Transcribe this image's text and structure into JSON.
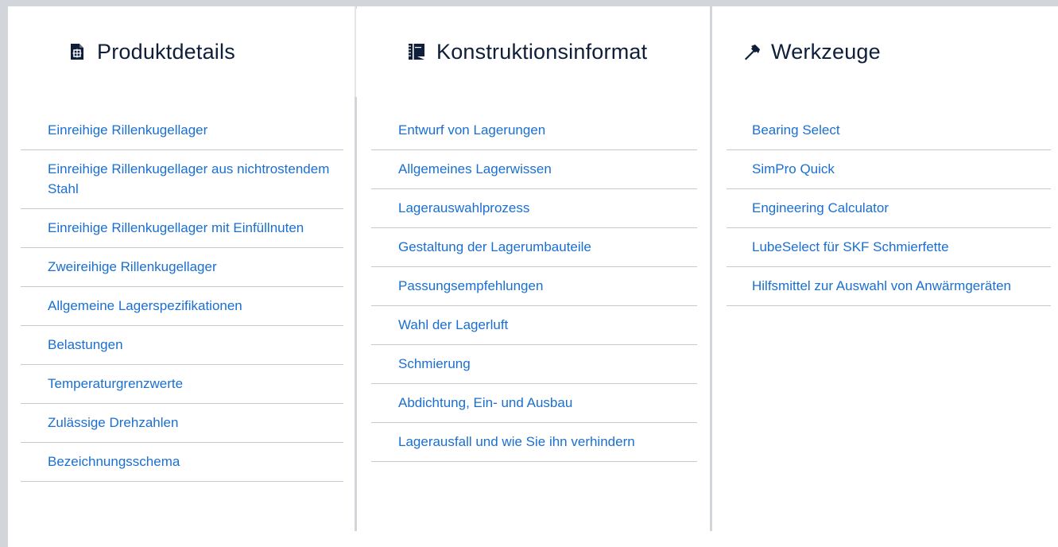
{
  "columns": [
    {
      "title": "Produktdetails",
      "icon": "document-icon",
      "items": [
        "Einreihige Rillenkugellager",
        "Einreihige Rillenkugellager aus nichtrostendem Stahl",
        "Einreihige Rillenkugellager mit Einfüllnuten",
        "Zweireihige Rillenkugellager",
        "Allgemeine Lagerspezifikationen",
        "Belastungen",
        "Temperaturgrenzwerte",
        "Zulässige Drehzahlen",
        "Bezeichnungsschema"
      ]
    },
    {
      "title": "Konstruktionsinformat",
      "icon": "blueprint-icon",
      "items": [
        "Entwurf von Lagerungen",
        "Allgemeines Lagerwissen",
        "Lagerauswahlprozess",
        "Gestaltung der Lagerumbauteile",
        "Passungsempfehlungen",
        "Wahl der Lagerluft",
        "Schmierung",
        "Abdichtung, Ein- und Ausbau",
        "Lagerausfall und wie Sie ihn verhindern"
      ]
    },
    {
      "title": "Werkzeuge",
      "icon": "hammer-icon",
      "items": [
        "Bearing Select",
        "SimPro Quick",
        "Engineering Calculator",
        "LubeSelect für SKF Schmierfette",
        "Hilfsmittel zur Auswahl von Anwärmgeräten"
      ]
    }
  ],
  "colors": {
    "link": "#1a6fd1",
    "heading": "#0f1e3a",
    "divider": "#c6cacf",
    "frame": "#d2d6da"
  }
}
